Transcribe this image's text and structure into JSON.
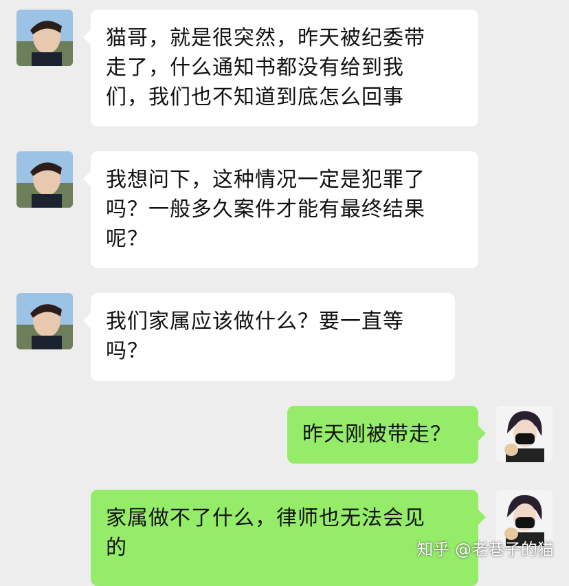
{
  "colors": {
    "background": "#ededed",
    "incoming_bubble": "#ffffff",
    "outgoing_bubble": "#95ec69"
  },
  "messages": [
    {
      "side": "incoming",
      "avatar": "contact-avatar",
      "text": "猫哥，就是很突然，昨天被纪委带\n走了，什么通知书都没有给到我\n们，我们也不知道到底怎么回事"
    },
    {
      "side": "incoming",
      "avatar": "contact-avatar",
      "text": "我想问下，这种情况一定是犯罪了\n吗？一般多久案件才能有最终结果\n呢？"
    },
    {
      "side": "incoming",
      "avatar": "contact-avatar",
      "text": "我们家属应该做什么？要一直等\n吗？"
    },
    {
      "side": "outgoing",
      "avatar": "self-avatar",
      "text": "昨天刚被带走？"
    },
    {
      "side": "outgoing",
      "avatar": "self-avatar",
      "text": "家属做不了什么，律师也无法会见\n的"
    }
  ],
  "watermark": "知乎 @老巷子的猫"
}
